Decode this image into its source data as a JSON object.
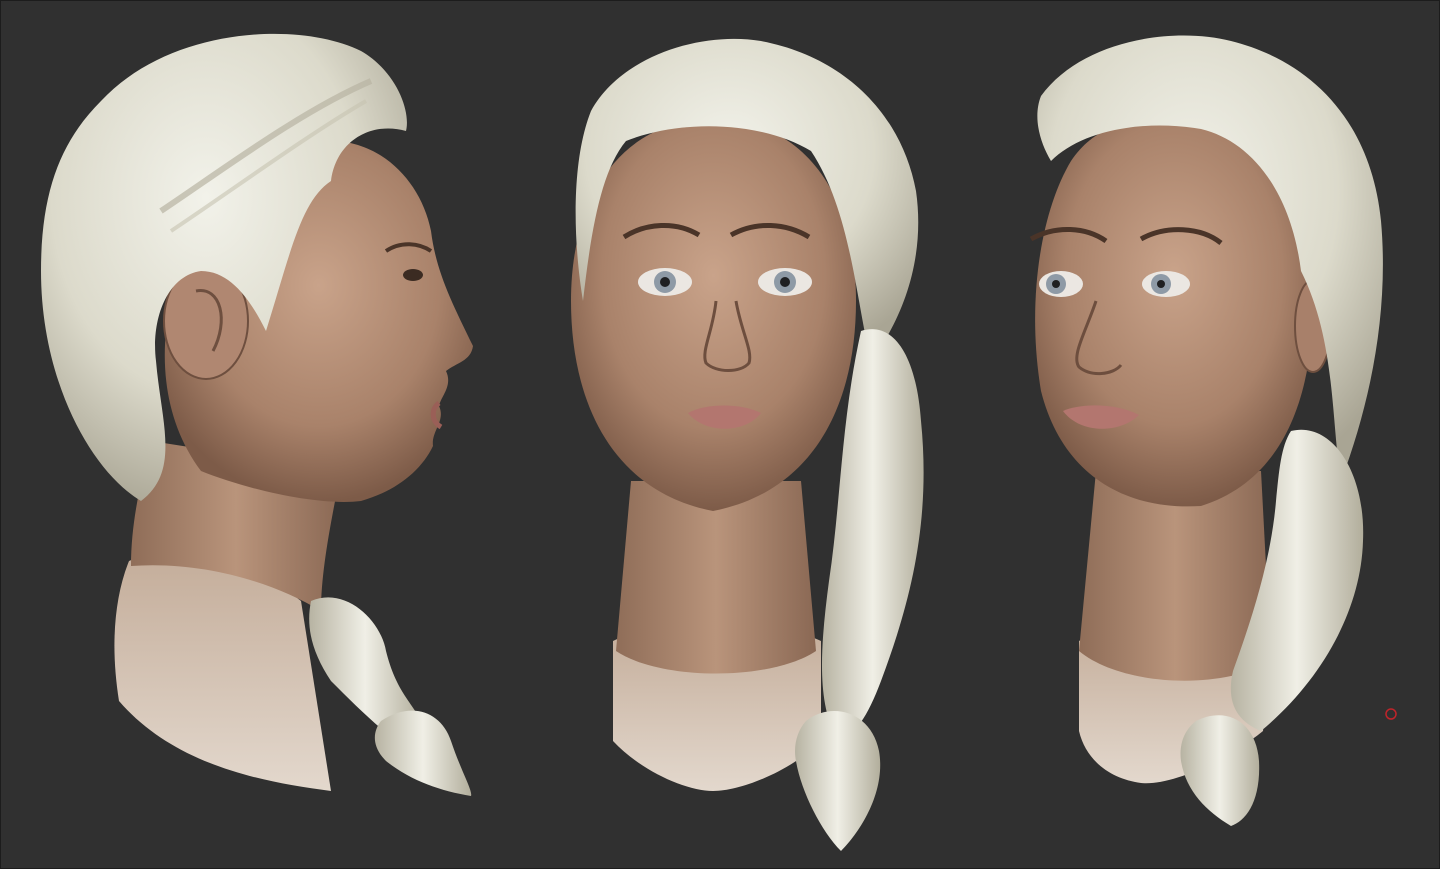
{
  "viewport": {
    "background": "#303030",
    "border": "#1c1c1c"
  },
  "colors": {
    "skin_light": "#c9a38a",
    "skin_mid": "#a9826a",
    "skin_dark": "#7d5b48",
    "hair_light": "#eeeee4",
    "hair_mid": "#d8d6c6",
    "hair_dark": "#a9a594",
    "shoulder_clay": "#d9cfc4",
    "iris": "#8e9aa6",
    "lips": "#b3766f",
    "marker": "#c0242a"
  },
  "views": [
    {
      "label": "side-profile"
    },
    {
      "label": "front"
    },
    {
      "label": "three-quarter"
    }
  ],
  "marker": {
    "icon": "red-circle-marker"
  }
}
